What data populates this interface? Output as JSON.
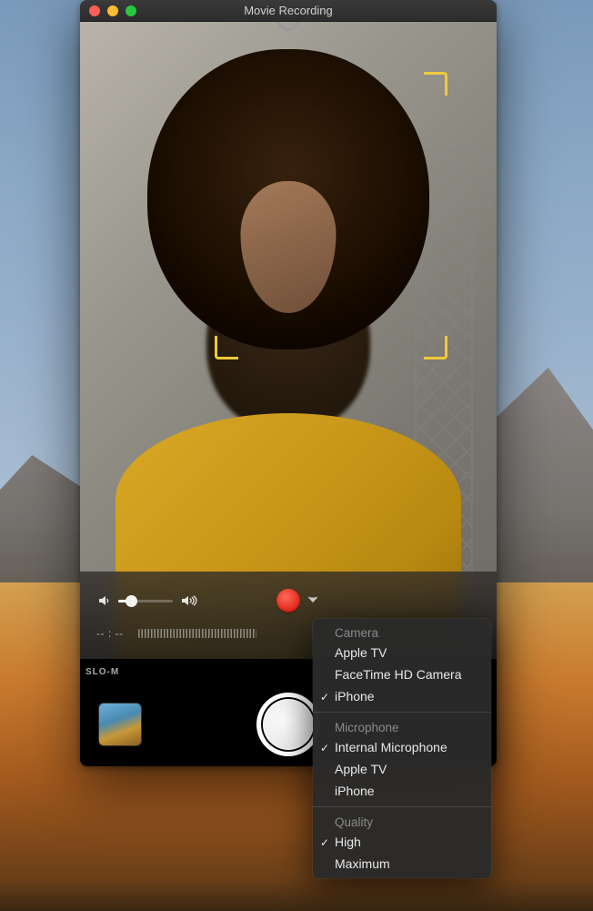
{
  "window": {
    "title": "Movie Recording"
  },
  "controls": {
    "time_display": "-- : --",
    "slomo_label": "SLO-M"
  },
  "dropdown": {
    "sections": [
      {
        "header": "Camera",
        "items": [
          {
            "label": "Apple TV",
            "checked": false
          },
          {
            "label": "FaceTime HD Camera",
            "checked": false
          },
          {
            "label": "iPhone",
            "checked": true
          }
        ]
      },
      {
        "header": "Microphone",
        "items": [
          {
            "label": "Internal Microphone",
            "checked": true
          },
          {
            "label": "Apple TV",
            "checked": false
          },
          {
            "label": "iPhone",
            "checked": false
          }
        ]
      },
      {
        "header": "Quality",
        "items": [
          {
            "label": "High",
            "checked": true
          },
          {
            "label": "Maximum",
            "checked": false
          }
        ]
      }
    ]
  }
}
